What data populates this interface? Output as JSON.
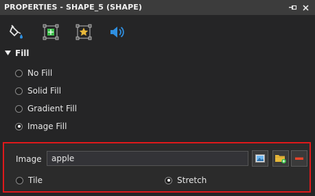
{
  "window": {
    "title": "PROPERTIES - SHAPE_5 (SHAPE)"
  },
  "toolbar": {
    "icons": [
      "fill-bucket-icon",
      "resize-icon",
      "star-frame-icon",
      "sound-icon"
    ]
  },
  "fill": {
    "section_label": "Fill",
    "options": [
      {
        "label": "No Fill",
        "selected": false
      },
      {
        "label": "Solid Fill",
        "selected": false
      },
      {
        "label": "Gradient Fill",
        "selected": false
      },
      {
        "label": "Image Fill",
        "selected": true
      }
    ]
  },
  "image": {
    "label": "Image",
    "value": "apple",
    "scale_options": [
      {
        "label": "Tile",
        "selected": false
      },
      {
        "label": "Stretch",
        "selected": true
      }
    ]
  },
  "colors": {
    "accent_red": "#e0191b",
    "icon_blue": "#2f8fe0",
    "icon_green": "#3cbf4a",
    "icon_gold": "#e8b83a"
  }
}
